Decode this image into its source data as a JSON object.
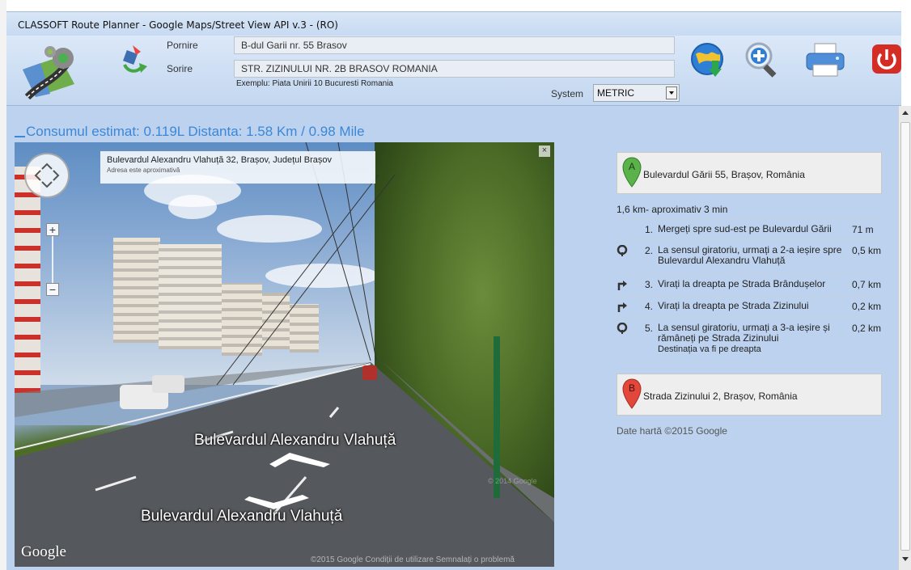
{
  "window": {
    "title": "CLASSOFT Route Planner - Google Maps/Street View API v.3 - (RO)"
  },
  "form": {
    "start_label": "Pornire",
    "start_value": "B-dul Garii nr. 55 Brasov",
    "end_label": "Sorire",
    "end_value": "STR. ZIZINULUI NR. 2B BRASOV  ROMANIA",
    "hint": "Exemplu: Piata Unirii 10 Bucuresti Romania",
    "system_label": "System",
    "system_value": "METRIC"
  },
  "toolbar_icons": [
    "globe-download-icon",
    "zoom-in-icon",
    "printer-icon",
    "power-icon"
  ],
  "estimate": "Consumul estimat: 0.119L Distanta: 1.58 Km / 0.98 Mile",
  "streetview": {
    "address": "Bulevardul Alexandru Vlahuță 32, Brașov, Județul Brașov",
    "address_note": "Adresa este aproximativă",
    "street_label_top": "Bulevardul Alexandru Vlahuță",
    "street_label_bottom": "Bulevardul Alexandru Vlahuță",
    "google": "Google",
    "terms": "©2015 Google   Condiții de utilizare   Semnalați o problemă",
    "copyright": "© 2014 Google",
    "close": "×",
    "zoom_in": "+",
    "zoom_out": "−"
  },
  "directions": {
    "start_marker": "A",
    "start_address": "Bulevardul Gării 55, Brașov, România",
    "summary": "1,6 km- aproximativ 3 min",
    "steps": [
      {
        "icon": "",
        "num": "1.",
        "text": "Mergeți spre sud-est pe Bulevardul Gării",
        "dist": "71 m"
      },
      {
        "icon": "roundabout-icon",
        "num": "2.",
        "text": "La sensul giratoriu, urmați a 2-a ieșire spre Bulevardul Alexandru Vlahuță",
        "dist": "0,5 km"
      },
      {
        "icon": "turn-right-icon",
        "num": "3.",
        "text": "Virați la dreapta pe Strada Brândușelor",
        "dist": "0,7 km"
      },
      {
        "icon": "turn-right-icon",
        "num": "4.",
        "text": "Virați la dreapta pe Strada Zizinului",
        "dist": "0,2 km"
      },
      {
        "icon": "roundabout-icon",
        "num": "5.",
        "text": "La sensul giratoriu, urmați a 3-a ieșire și rămâneți pe Strada Zizinului",
        "note": "Destinația va fi pe dreapta",
        "dist": "0,2 km"
      }
    ],
    "end_marker": "B",
    "end_address": "Strada Zizinului 2, Brașov, România",
    "credit": "Date hartă ©2015 Google"
  },
  "colors": {
    "accent": "#3c87d6",
    "panel": "#bcd2ee",
    "marker_a": "#5cb24a",
    "marker_b": "#e2473b"
  }
}
